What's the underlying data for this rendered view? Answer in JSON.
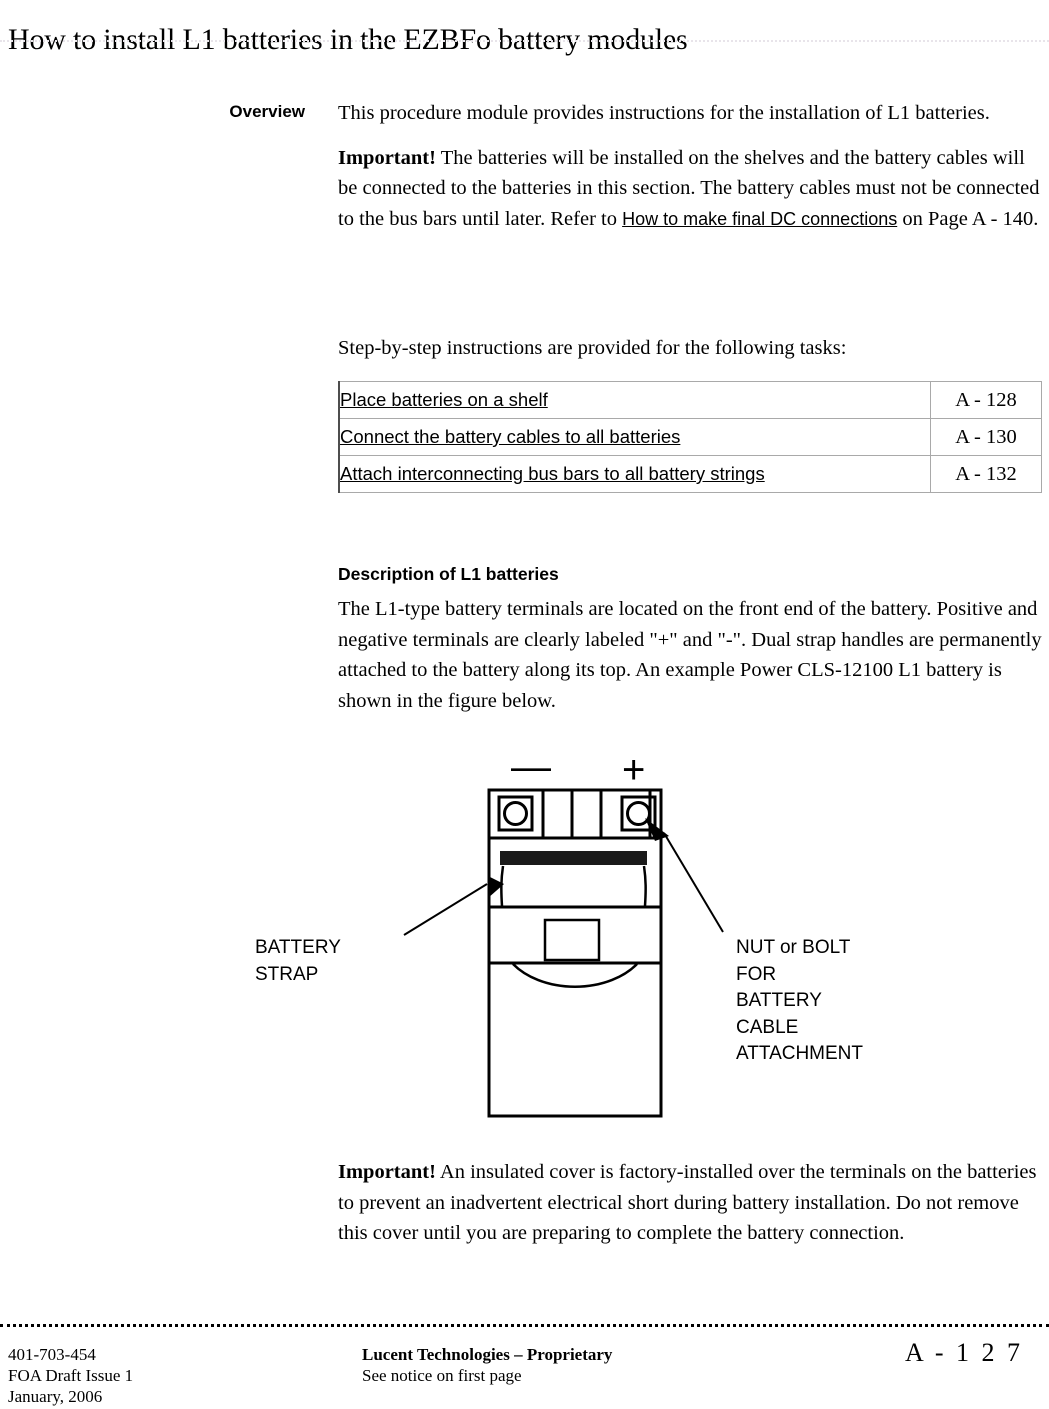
{
  "header": {
    "title": "How to install L1 batteries in the EZBFo battery modules"
  },
  "overview": {
    "label": "Overview",
    "paragraph1": "This procedure module provides instructions for the installation of L1 batteries.",
    "important_label": "Important!",
    "important_text_before_link": " The batteries will be installed on the shelves and the battery cables will be connected to the batteries in this section. The battery cables must not be connected to the bus bars until later. Refer to ",
    "important_link": "How to make final DC connections",
    "important_text_after_link": " on Page  A - 140.",
    "tasks_intro": "Step-by-step instructions are provided for the following tasks:"
  },
  "task_table": {
    "rows": [
      {
        "task": "Place batteries on a shelf",
        "page": "A - 128"
      },
      {
        "task": "Connect the battery cables to all batteries",
        "page": "A - 130"
      },
      {
        "task": "Attach interconnecting bus bars to all battery strings",
        "page": "A - 132"
      }
    ]
  },
  "description": {
    "heading": "Description of L1 batteries",
    "paragraph": "The L1-type battery terminals are located on the front end of the battery. Positive and negative terminals are clearly labeled \"+\" and \"-\". Dual strap handles are permanently attached to the battery along its top. An example Power CLS-12100 L1 battery is shown in the figure below."
  },
  "figure": {
    "negative_symbol": "—",
    "positive_symbol": "+",
    "callout_left": "BATTERY\nSTRAP",
    "callout_right": "NUT or BOLT\nFOR\nBATTERY\nCABLE\nATTACHMENT"
  },
  "note": {
    "important_label": "Important!",
    "text": "   An insulated cover is factory-installed over the terminals on the batteries to prevent an inadvertent electrical short during battery installation. Do not remove this cover until you are preparing to complete the battery connection."
  },
  "footer": {
    "doc_number": "401-703-454",
    "issue": "FOA Draft Issue 1",
    "date": "January, 2006",
    "proprietary_title": "Lucent Technologies – Proprietary",
    "proprietary_note": "See notice on first page",
    "page_number": "A -  1 2 7"
  },
  "colors": {
    "text": "#000000",
    "header_rule": "#e8e4ea",
    "table_border": "#a9a9a9",
    "table_left_border": "#4d4d4d"
  }
}
